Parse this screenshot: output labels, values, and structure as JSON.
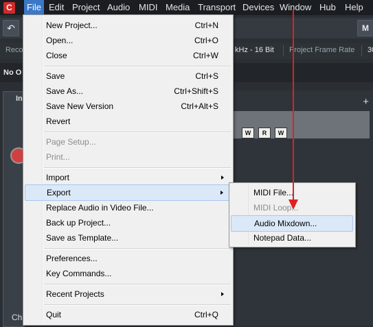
{
  "menubar": {
    "app_icon": "cubase-logo-icon",
    "items": [
      "File",
      "Edit",
      "Project",
      "Audio",
      "MIDI",
      "Media",
      "Transport",
      "Devices",
      "Window",
      "Hub",
      "Help"
    ],
    "active": "File"
  },
  "toolbar": {
    "undo_icon": "undo-icon",
    "right_button": "M"
  },
  "status": {
    "left_text": "Reco",
    "sample_format": "kHz - 16 Bit",
    "frame_rate_label": "Project Frame Rate",
    "frame_rate_value": "30"
  },
  "info_row": {
    "text": "No O"
  },
  "inspector": {
    "tab_label": "In",
    "bottom_label": "Ch"
  },
  "track": {
    "buttons": [
      "W",
      "R",
      "W"
    ],
    "add_label": "+"
  },
  "file_menu": {
    "items": [
      {
        "label": "New Project...",
        "shortcut": "Ctrl+N"
      },
      {
        "label": "Open...",
        "shortcut": "Ctrl+O"
      },
      {
        "label": "Close",
        "shortcut": "Ctrl+W"
      },
      {
        "label": "Save",
        "shortcut": "Ctrl+S"
      },
      {
        "label": "Save As...",
        "shortcut": "Ctrl+Shift+S"
      },
      {
        "label": "Save New Version",
        "shortcut": "Ctrl+Alt+S"
      },
      {
        "label": "Revert",
        "shortcut": ""
      },
      {
        "label": "Page Setup...",
        "shortcut": "",
        "disabled": true
      },
      {
        "label": "Print...",
        "shortcut": "",
        "disabled": true
      },
      {
        "label": "Import",
        "shortcut": "",
        "submenu": true
      },
      {
        "label": "Export",
        "shortcut": "",
        "submenu": true,
        "highlighted": true
      },
      {
        "label": "Replace Audio in Video File...",
        "shortcut": ""
      },
      {
        "label": "Back up Project...",
        "shortcut": ""
      },
      {
        "label": "Save as Template...",
        "shortcut": ""
      },
      {
        "label": "Preferences...",
        "shortcut": ""
      },
      {
        "label": "Key Commands...",
        "shortcut": ""
      },
      {
        "label": "Recent Projects",
        "shortcut": "",
        "submenu": true
      },
      {
        "label": "Quit",
        "shortcut": "Ctrl+Q"
      }
    ]
  },
  "export_menu": {
    "items": [
      {
        "label": "MIDI File..."
      },
      {
        "label": "MIDI Loop...",
        "disabled": true
      },
      {
        "label": "Audio Mixdown...",
        "highlighted": true
      },
      {
        "label": "Notepad Data..."
      }
    ]
  },
  "annotation": {
    "color": "#e02020"
  }
}
